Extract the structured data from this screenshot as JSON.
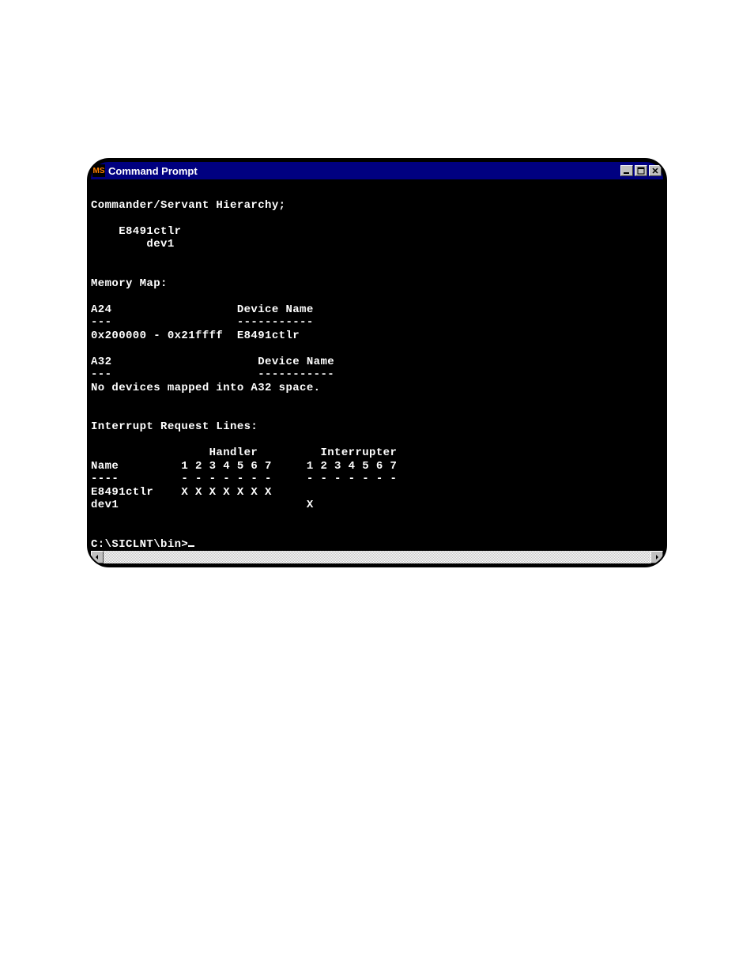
{
  "window": {
    "title": "Command Prompt",
    "sys_icon_label": "MS"
  },
  "terminal": {
    "lines": [
      "",
      "Commander/Servant Hierarchy;",
      "",
      "    E8491ctlr",
      "        dev1",
      "",
      "",
      "Memory Map:",
      "",
      "A24                  Device Name",
      "---                  -----------",
      "0x200000 - 0x21ffff  E8491ctlr",
      "",
      "A32                     Device Name",
      "---                     -----------",
      "No devices mapped into A32 space.",
      "",
      "",
      "Interrupt Request Lines:",
      "",
      "                 Handler         Interrupter",
      "Name         1 2 3 4 5 6 7     1 2 3 4 5 6 7",
      "----         - - - - - - -     - - - - - - -",
      "E8491ctlr    X X X X X X X",
      "dev1                           X",
      "",
      ""
    ],
    "prompt": "C:\\SICLNT\\bin>"
  }
}
